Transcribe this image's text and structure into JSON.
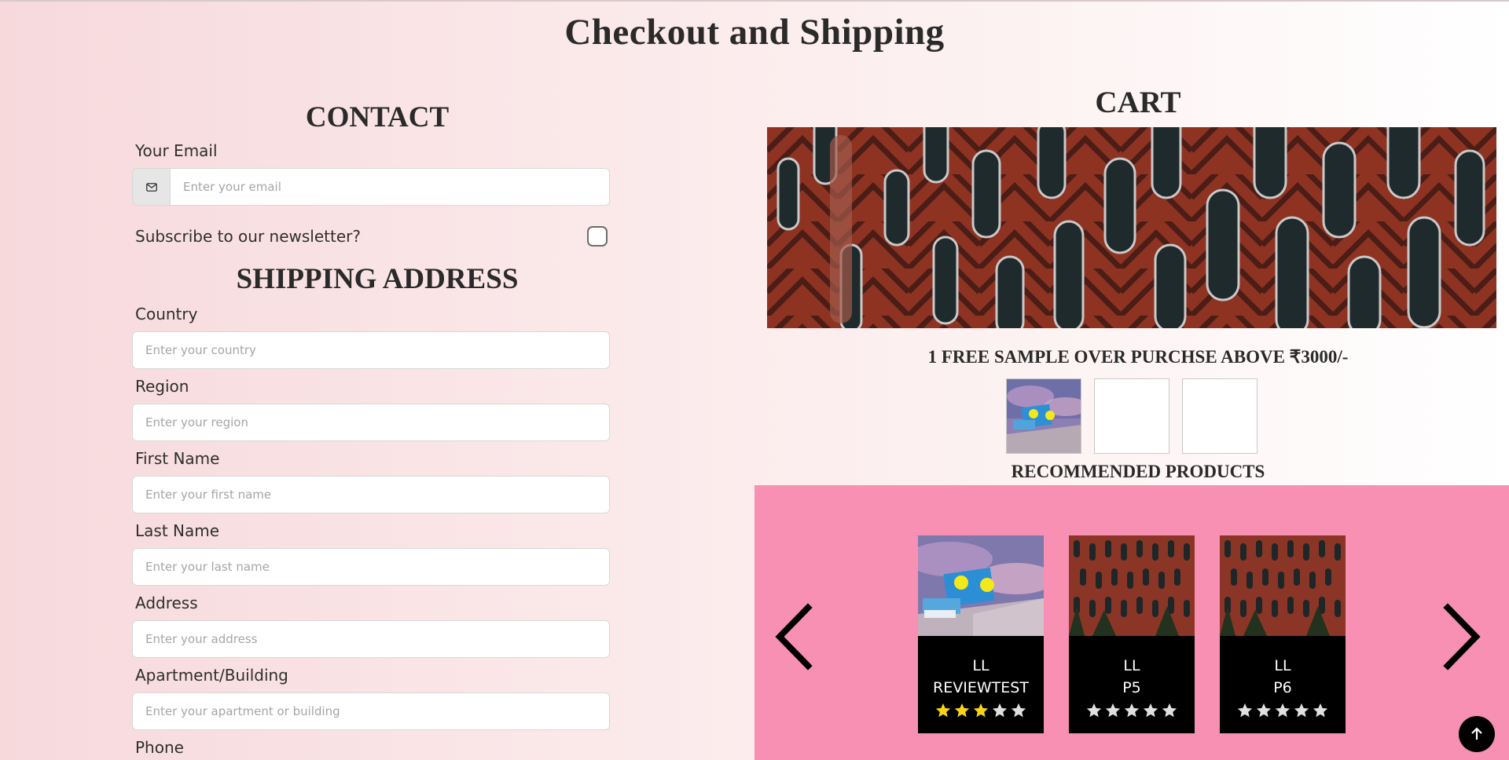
{
  "page": {
    "title": "Checkout and Shipping"
  },
  "contact": {
    "heading": "CONTACT",
    "email_label": "Your Email",
    "email_placeholder": "Enter your email",
    "email_icon": "envelope-icon",
    "newsletter_label": "Subscribe to our newsletter?"
  },
  "shipping": {
    "heading": "SHIPPING ADDRESS",
    "fields": [
      {
        "label": "Country",
        "placeholder": "Enter your country"
      },
      {
        "label": "Region",
        "placeholder": "Enter your region"
      },
      {
        "label": "First Name",
        "placeholder": "Enter your first name"
      },
      {
        "label": "Last Name",
        "placeholder": "Enter your last name"
      },
      {
        "label": "Address",
        "placeholder": "Enter your address"
      },
      {
        "label": "Apartment/Building",
        "placeholder": "Enter your apartment or building"
      },
      {
        "label": "Phone",
        "placeholder": ""
      }
    ]
  },
  "cart": {
    "heading": "CART",
    "free_sample_text": "1 FREE SAMPLE OVER PURCHSE ABOVE ₹3000/-",
    "sample_slots": 3,
    "sample_slots_filled": 1
  },
  "recommended": {
    "heading": "RECOMMENDED PRODUCTS",
    "products": [
      {
        "line1": "LL",
        "line2": "REVIEWTEST",
        "rating": 3,
        "max_rating": 5
      },
      {
        "line1": "LL",
        "line2": "P5",
        "rating": 0,
        "max_rating": 5
      },
      {
        "line1": "LL",
        "line2": "P6",
        "rating": 0,
        "max_rating": 5
      }
    ],
    "prev_icon": "chevron-left-icon",
    "next_icon": "chevron-right-icon"
  },
  "colors": {
    "panel_pink": "#f790b3",
    "star_filled": "#f7d31a",
    "star_empty": "#e0e0e0"
  },
  "scroll_top_icon": "arrow-up-icon"
}
